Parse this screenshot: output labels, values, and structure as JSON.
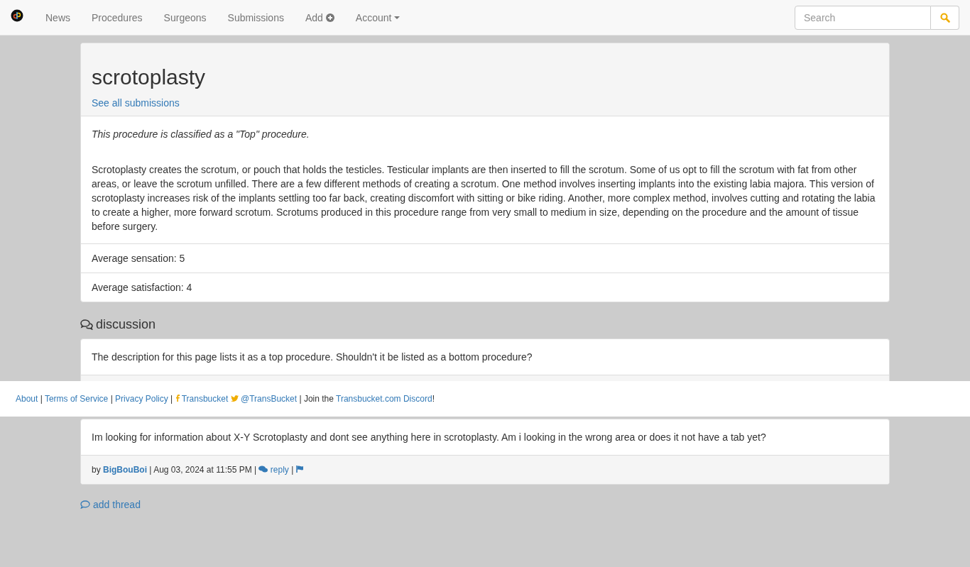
{
  "navbar": {
    "items": [
      {
        "label": "News",
        "kind": "plain"
      },
      {
        "label": "Procedures",
        "kind": "plain"
      },
      {
        "label": "Surgeons",
        "kind": "plain"
      },
      {
        "label": "Submissions",
        "kind": "plain"
      },
      {
        "label": "Add",
        "kind": "add"
      },
      {
        "label": "Account",
        "kind": "dropdown"
      }
    ],
    "search": {
      "placeholder": "Search"
    }
  },
  "procedure": {
    "title": "scrotoplasty",
    "link": "See all submissions",
    "classification": "This procedure is classified as a \"Top\" procedure.",
    "description": "Scrotoplasty creates the scrotum, or pouch that holds the testicles. Testicular implants are then inserted to fill the scrotum. Some of us opt to fill the scrotum with fat from other areas, or leave the scrotum unfilled. There are a few different methods of creating a scrotum. One method involves inserting implants into the existing labia majora. This version of scrotoplasty increases risk of the implants settling too far back, creating discomfort with sitting or bike riding. Another, more complex method, involves cutting and rotating the labia to create a higher, more forward scrotum. Scrotums produced in this procedure range from very small to medium in size, depending on the procedure and the amount of tissue before surgery.",
    "stats": [
      "Average sensation: 5",
      "Average satisfaction: 4"
    ]
  },
  "discussion": {
    "heading": "discussion",
    "threads": [
      {
        "text": "The description for this page lists it as a top procedure. Shouldn't it be listed as a bottom procedure?"
      },
      {
        "text": "Im looking for information about X-Y Scrotoplasty and dont see anything here in scrotoplasty. Am i looking in the wrong area or does it not have a tab yet?",
        "by": "by",
        "author": "BigBouBoi",
        "date": "| Aug 03, 2024 at 11:55 PM |",
        "reply": "reply",
        "sep": "|"
      }
    ],
    "add_thread": "add thread"
  },
  "footer": {
    "sep": "|",
    "links": [
      "About",
      "Terms of Service",
      "Privacy Policy"
    ],
    "facebook": "Transbucket",
    "twitter": "@TransBucket",
    "join": "Join the",
    "discord": "Transbucket.com Discord",
    "end": "!"
  }
}
